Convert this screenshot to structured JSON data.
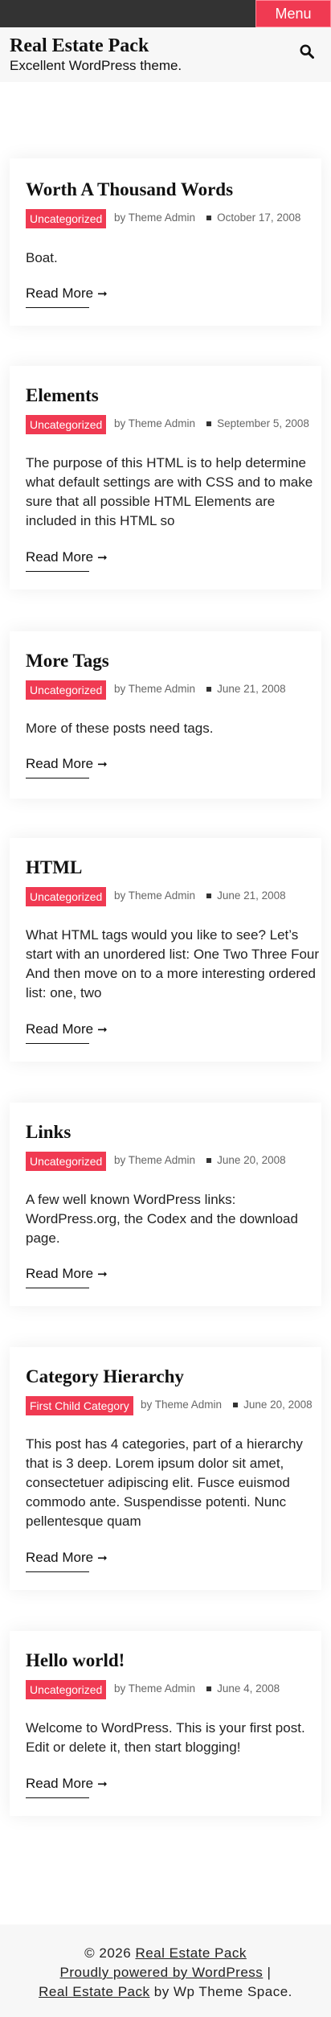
{
  "topbar": {
    "menu_label": "Menu"
  },
  "header": {
    "site_title": "Real Estate Pack",
    "site_description": "Excellent WordPress theme.",
    "search_icon": "search-icon"
  },
  "posts": [
    {
      "title": "Worth A Thousand Words",
      "category": "Uncategorized",
      "author": "by Theme Admin",
      "date": "October 17, 2008",
      "excerpt": "Boat.",
      "read_more": "Read More"
    },
    {
      "title": "Elements",
      "category": "Uncategorized",
      "author": "by Theme Admin",
      "date": "September 5, 2008",
      "excerpt": "The purpose of this HTML is to help determine what default settings are with CSS and to make sure that all possible HTML Elements are included in this HTML so",
      "read_more": "Read More"
    },
    {
      "title": "More Tags",
      "category": "Uncategorized",
      "author": "by Theme Admin",
      "date": "June 21, 2008",
      "excerpt": "More of these posts need tags.",
      "read_more": "Read More"
    },
    {
      "title": "HTML",
      "category": "Uncategorized",
      "author": "by Theme Admin",
      "date": "June 21, 2008",
      "excerpt": "What HTML tags would you like to see? Let’s start with an unordered list: One Two Three Four And then move on to a more interesting ordered list: one, two",
      "read_more": "Read More"
    },
    {
      "title": "Links",
      "category": "Uncategorized",
      "author": "by Theme Admin",
      "date": "June 20, 2008",
      "excerpt": "A few well known WordPress links: WordPress.org, the Codex and the download page.",
      "read_more": "Read More"
    },
    {
      "title": "Category Hierarchy",
      "category": "First Child Category",
      "author": "by Theme Admin",
      "date": "June 20, 2008",
      "excerpt": "This post has 4 categories, part of a hierarchy that is 3 deep. Lorem ipsum dolor sit amet, consectetuer adipiscing elit. Fusce euismod commodo ante. Suspendisse potenti. Nunc pellentesque quam",
      "read_more": "Read More"
    },
    {
      "title": "Hello world!",
      "category": "Uncategorized",
      "author": "by Theme Admin",
      "date": "June 4, 2008",
      "excerpt": "Welcome to WordPress. This is your first post. Edit or delete it, then start blogging!",
      "read_more": "Read More"
    }
  ],
  "footer": {
    "copyright_prefix": "© 2026",
    "site_link": "Real Estate Pack",
    "powered_by": "Proudly powered by WordPress",
    "separator": "|",
    "theme_link": "Real Estate Pack",
    "theme_suffix": "by Wp Theme Space."
  },
  "colors": {
    "accent": "#f03a52",
    "topbar": "#333333",
    "header_bg": "#f7f7f7"
  }
}
